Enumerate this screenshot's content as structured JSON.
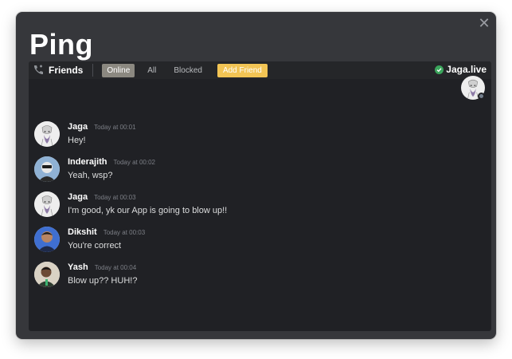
{
  "app": {
    "title": "Ping",
    "close_glyph": "✕"
  },
  "topbar": {
    "friends_label": "Friends",
    "tabs": [
      {
        "label": "Online",
        "active": true
      },
      {
        "label": "All",
        "active": false
      },
      {
        "label": "Blocked",
        "active": false
      }
    ],
    "add_friend_label": "Add Friend",
    "accent_color": "#f2c454"
  },
  "user": {
    "status_name": "Jaga.live",
    "status_color": "#3ba55c"
  },
  "messages": [
    {
      "author": "Jaga",
      "time": "Today at 00:01",
      "text": "Hey!"
    },
    {
      "author": "Inderajith",
      "time": "Today at 00:02",
      "text": "Yeah, wsp?"
    },
    {
      "author": "Jaga",
      "time": "Today at 00:03",
      "text": "I'm good, yk our App is going to blow up!!"
    },
    {
      "author": "Dikshit",
      "time": "Today at 00:03",
      "text": "You're correct"
    },
    {
      "author": "Yash",
      "time": "Today at 00:04",
      "text": "Blow up?? HUH!?"
    }
  ]
}
